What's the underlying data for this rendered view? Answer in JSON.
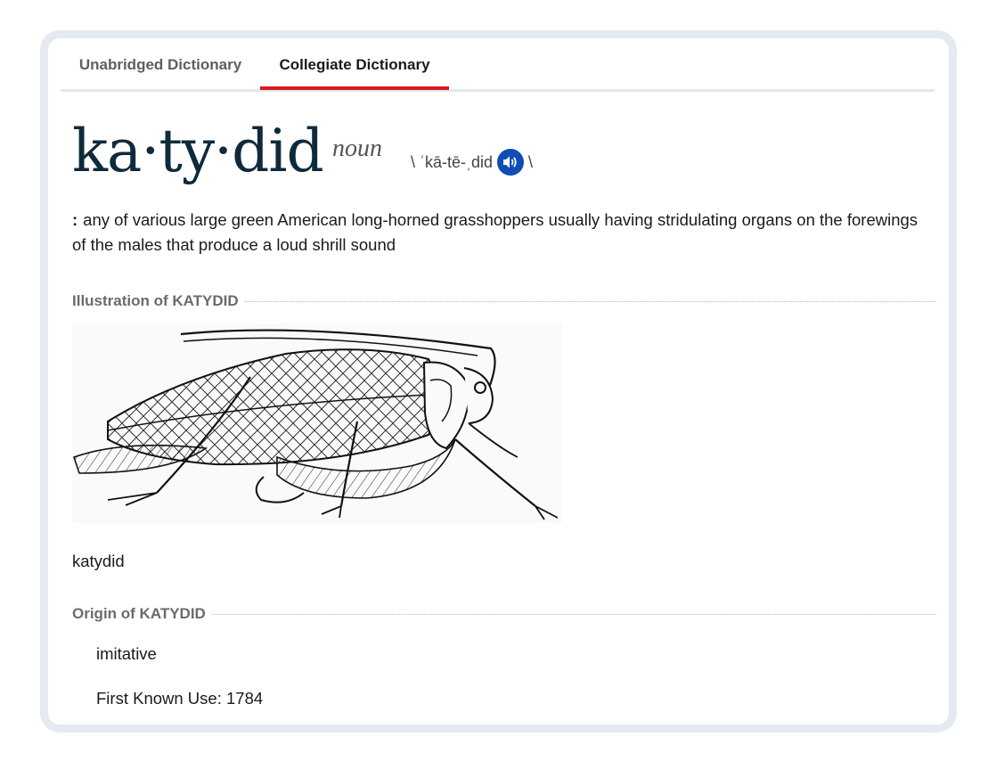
{
  "tabs": [
    {
      "label": "Unabridged Dictionary",
      "active": false
    },
    {
      "label": "Collegiate Dictionary",
      "active": true
    }
  ],
  "entry": {
    "headword": "ka·ty·did",
    "part_of_speech": "noun",
    "pron_open": "\\ ˈkā-tē-ˌdid",
    "pron_close": "\\",
    "audio_icon": "speaker-icon",
    "definition_marker": ":",
    "definition": "any of various large green American long-horned grasshoppers usually having stridulating organs on the forewings of the males that produce a loud shrill sound"
  },
  "illustration": {
    "heading": "Illustration of KATYDID",
    "caption": "katydid"
  },
  "origin": {
    "heading": "Origin of KATYDID",
    "text": "imitative",
    "first_known_use": "First Known Use: 1784"
  },
  "colors": {
    "accent": "#d71920",
    "headword": "#0f2a3a",
    "audio_button": "#0f4db5",
    "section_heading": "#6b6b6b"
  }
}
